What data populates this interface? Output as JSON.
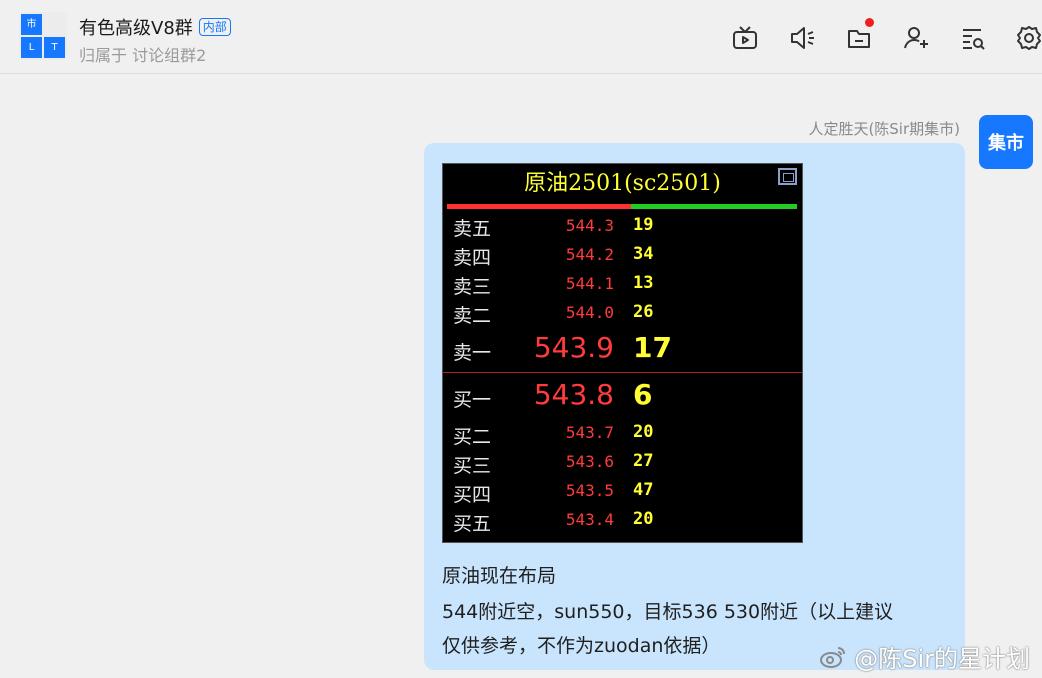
{
  "header": {
    "avatar_tiles": [
      "市",
      "",
      "L",
      "T"
    ],
    "title": "有色高级V8群",
    "tag": "内部",
    "subtitle": "归属于 讨论组群2",
    "toolbar": [
      "tv-icon",
      "speaker-icon",
      "folder-icon",
      "add-user-icon",
      "search-history-icon",
      "settings-icon"
    ]
  },
  "message": {
    "sender_name": "人定胜天(陈Sir期集市)",
    "sender_avatar_text": "集市",
    "quote": {
      "title": "原油2501(sc2501)",
      "asks": [
        {
          "label": "卖五",
          "price": "544.3",
          "volume": "19"
        },
        {
          "label": "卖四",
          "price": "544.2",
          "volume": "34"
        },
        {
          "label": "卖三",
          "price": "544.1",
          "volume": "13"
        },
        {
          "label": "卖二",
          "price": "544.0",
          "volume": "26"
        },
        {
          "label": "卖一",
          "price": "543.9",
          "volume": "17"
        }
      ],
      "bids": [
        {
          "label": "买一",
          "price": "543.8",
          "volume": "6"
        },
        {
          "label": "买二",
          "price": "543.7",
          "volume": "20"
        },
        {
          "label": "买三",
          "price": "543.6",
          "volume": "27"
        },
        {
          "label": "买四",
          "price": "543.5",
          "volume": "47"
        },
        {
          "label": "买五",
          "price": "543.4",
          "volume": "20"
        }
      ]
    },
    "text_lines": [
      "原油现在布局",
      "544附近空，sun550，目标536 530附近（以上建议",
      "仅供参考，不作为zuodan依据）"
    ]
  },
  "watermark": "@陈Sir的星计划",
  "colors": {
    "accent": "#1677ff",
    "bubble": "#c9e4fd",
    "ask_price": "#ff3b3b",
    "volume": "#ffff33"
  }
}
